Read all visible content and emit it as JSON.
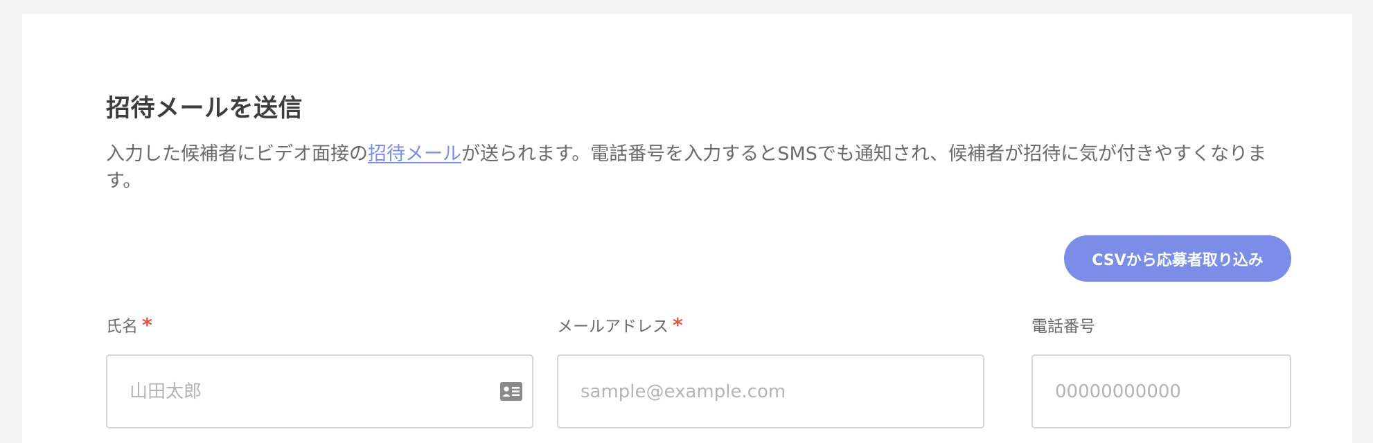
{
  "invite": {
    "title": "招待メールを送信",
    "description_before": "入力した候補者にビデオ面接の",
    "description_link": "招待メール",
    "description_after": "が送られます。電話番号を入力するとSMSでも通知され、候補者が招待に気が付きやすくなります。",
    "csv_button_label": "CSVから応募者取り込み"
  },
  "fields": {
    "name": {
      "label": "氏名",
      "required_mark": "*",
      "placeholder": "山田太郎",
      "icon": "contact-card-icon"
    },
    "email": {
      "label": "メールアドレス",
      "required_mark": "*",
      "placeholder": "sample@example.com"
    },
    "phone": {
      "label": "電話番号",
      "placeholder": "00000000000"
    }
  },
  "colors": {
    "accent": "#7b8de6",
    "required": "#e0533c",
    "background": "#f4f4f4"
  }
}
